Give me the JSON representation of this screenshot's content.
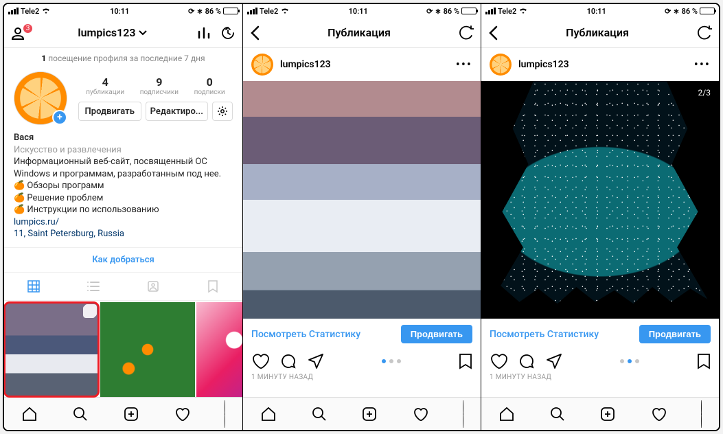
{
  "status": {
    "carrier": "Tele2",
    "time": "10:11",
    "battery_pct": "86 %"
  },
  "screen1": {
    "nav": {
      "title": "lumpics123",
      "badge": "3"
    },
    "visits": {
      "count": "1",
      "text": "посещение профиля за последние 7 дня"
    },
    "stats": {
      "posts_n": "4",
      "posts_l": "публикации",
      "followers_n": "9",
      "followers_l": "подписчики",
      "following_n": "0",
      "following_l": "подписки"
    },
    "buttons": {
      "promote": "Продвигать",
      "edit": "Редактиро..."
    },
    "bio": {
      "name": "Вася",
      "category": "Искусство и развлечения",
      "desc": "Информационный веб-сайт, посвященный ОС Windows и программам, разработанным под нее.",
      "line1": "🍊 Обзоры программ",
      "line2": "🍊 Решение проблем",
      "line3": "🍊 Инструкции по использованию",
      "url": "lumpics.ru/",
      "location": "11, Saint Petersburg, Russia"
    },
    "directions": "Как добраться"
  },
  "screen2": {
    "nav": {
      "title": "Публикация"
    },
    "username": "lumpics123",
    "stats_link": "Посмотреть Статистику",
    "promote": "Продвигать",
    "timestamp": "1 МИНУТУ НАЗАД",
    "carousel_index": 0
  },
  "screen3": {
    "nav": {
      "title": "Публикация"
    },
    "username": "lumpics123",
    "counter": "2/3",
    "stats_link": "Посмотреть Статистику",
    "promote": "Продвигать",
    "timestamp": "1 МИНУТУ НАЗАД",
    "carousel_index": 1
  }
}
